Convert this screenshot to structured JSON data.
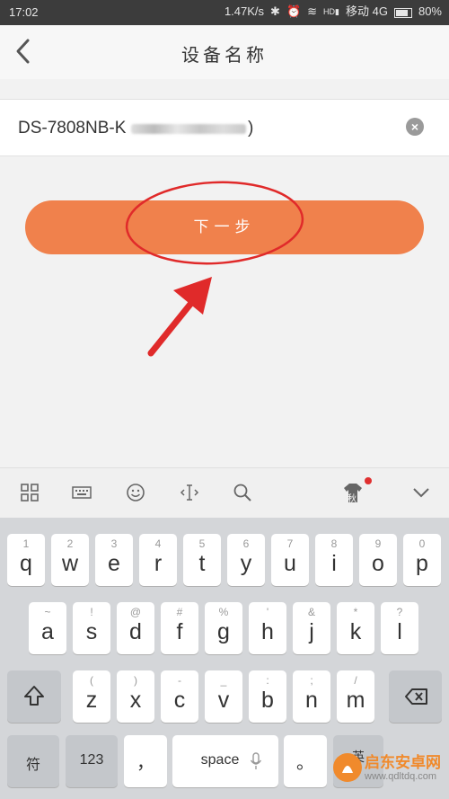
{
  "status_bar": {
    "time": "17:02",
    "speed": "1.47K/s",
    "carrier": "移动 4G",
    "battery": "80%",
    "hd_badge": "HD"
  },
  "nav": {
    "title": "设备名称",
    "back_icon": "chevron-left-icon"
  },
  "device_name": {
    "prefix": "DS-7808NB-K",
    "suffix": ")",
    "clear_icon": "clear-icon"
  },
  "next_button": {
    "label": "下一步",
    "color": "#f0814c"
  },
  "keyboard_toolbar": {
    "items": [
      "grid-icon",
      "keyboard-icon",
      "emoji-icon",
      "cursor-icon",
      "search-icon",
      "skin-icon",
      "collapse-icon"
    ],
    "skin_glyph": "秋"
  },
  "keyboard": {
    "row1": [
      {
        "hint": "1",
        "key": "q"
      },
      {
        "hint": "2",
        "key": "w"
      },
      {
        "hint": "3",
        "key": "e"
      },
      {
        "hint": "4",
        "key": "r"
      },
      {
        "hint": "5",
        "key": "t"
      },
      {
        "hint": "6",
        "key": "y"
      },
      {
        "hint": "7",
        "key": "u"
      },
      {
        "hint": "8",
        "key": "i"
      },
      {
        "hint": "9",
        "key": "o"
      },
      {
        "hint": "0",
        "key": "p"
      }
    ],
    "row2": [
      {
        "hint": "~",
        "key": "a"
      },
      {
        "hint": "!",
        "key": "s"
      },
      {
        "hint": "@",
        "key": "d"
      },
      {
        "hint": "#",
        "key": "f"
      },
      {
        "hint": "%",
        "key": "g"
      },
      {
        "hint": "'",
        "key": "h"
      },
      {
        "hint": "&",
        "key": "j"
      },
      {
        "hint": "*",
        "key": "k"
      },
      {
        "hint": "?",
        "key": "l"
      }
    ],
    "row3": [
      {
        "hint": "(",
        "key": "z"
      },
      {
        "hint": ")",
        "key": "x"
      },
      {
        "hint": "-",
        "key": "c"
      },
      {
        "hint": "_",
        "key": "v"
      },
      {
        "hint": ":",
        "key": "b"
      },
      {
        "hint": ";",
        "key": "n"
      },
      {
        "hint": "/",
        "key": "m"
      }
    ],
    "shift_icon": "shift-arrow-icon",
    "backspace_icon": "backspace-icon",
    "symbols_label": "符",
    "numbers_label": "123",
    "comma_label": "，",
    "space_label": "space",
    "period_label": "。",
    "lang_label": "英"
  },
  "watermark": {
    "name": "启东安卓网",
    "url": "www.qdltdq.com"
  }
}
